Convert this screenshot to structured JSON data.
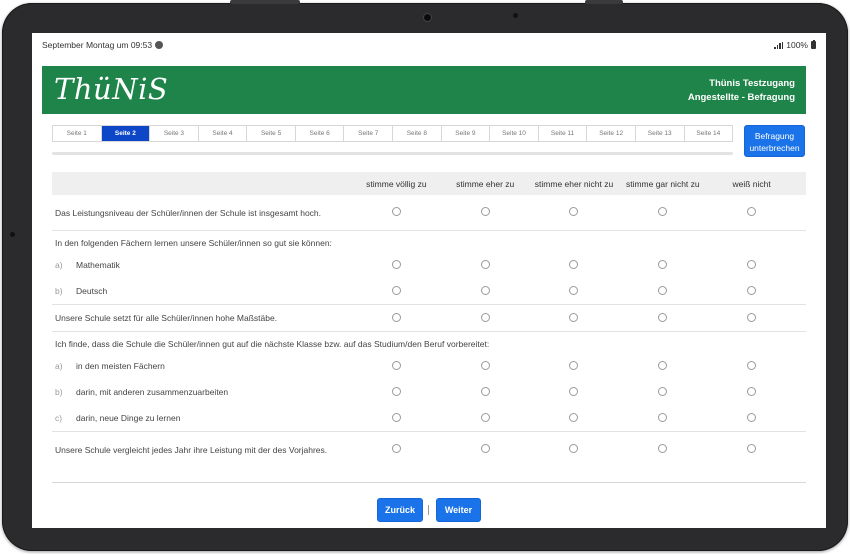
{
  "statusbar": {
    "time_text": "September Montag um 09:53",
    "battery_text": "100%"
  },
  "header": {
    "logo": "ThüNiS",
    "account_line1": "Thünis Testzugang",
    "account_line2": "Angestellte - Befragung"
  },
  "tabs": [
    {
      "label": "Seite 1",
      "active": false
    },
    {
      "label": "Seite 2",
      "active": true
    },
    {
      "label": "Seite 3",
      "active": false
    },
    {
      "label": "Seite 4",
      "active": false
    },
    {
      "label": "Seite 5",
      "active": false
    },
    {
      "label": "Seite 6",
      "active": false
    },
    {
      "label": "Seite 7",
      "active": false
    },
    {
      "label": "Seite 8",
      "active": false
    },
    {
      "label": "Seite 9",
      "active": false
    },
    {
      "label": "Seite 10",
      "active": false
    },
    {
      "label": "Seite 11",
      "active": false
    },
    {
      "label": "Seite 12",
      "active": false
    },
    {
      "label": "Seite 13",
      "active": false
    },
    {
      "label": "Seite 14",
      "active": false
    }
  ],
  "abort_button": "Befragung unterbrechen",
  "columns": [
    "stimme völlig zu",
    "stimme eher zu",
    "stimme eher nicht zu",
    "stimme gar nicht zu",
    "weiß nicht"
  ],
  "questions": {
    "q1": "Das Leistungsniveau der Schüler/innen der Schule ist insgesamt hoch.",
    "q2_intro": "In den folgenden Fächern lernen unsere Schüler/innen so gut sie können:",
    "q2a_letter": "a)",
    "q2a": "Mathematik",
    "q2b_letter": "b)",
    "q2b": "Deutsch",
    "q3": "Unsere Schule setzt für alle Schüler/innen hohe Maßstäbe.",
    "q4_intro": "Ich finde, dass die Schule die Schüler/innen gut auf die nächste Klasse bzw. auf das Studium/den Beruf vorbereitet:",
    "q4a_letter": "a)",
    "q4a": "in den meisten Fächern",
    "q4b_letter": "b)",
    "q4b": "darin, mit anderen zusammenzuarbeiten",
    "q4c_letter": "c)",
    "q4c": "darin, neue Dinge zu lernen",
    "q5": "Unsere Schule vergleicht jedes Jahr ihre Leistung mit der des Vorjahres."
  },
  "nav": {
    "back": "Zurück",
    "next": "Weiter"
  }
}
